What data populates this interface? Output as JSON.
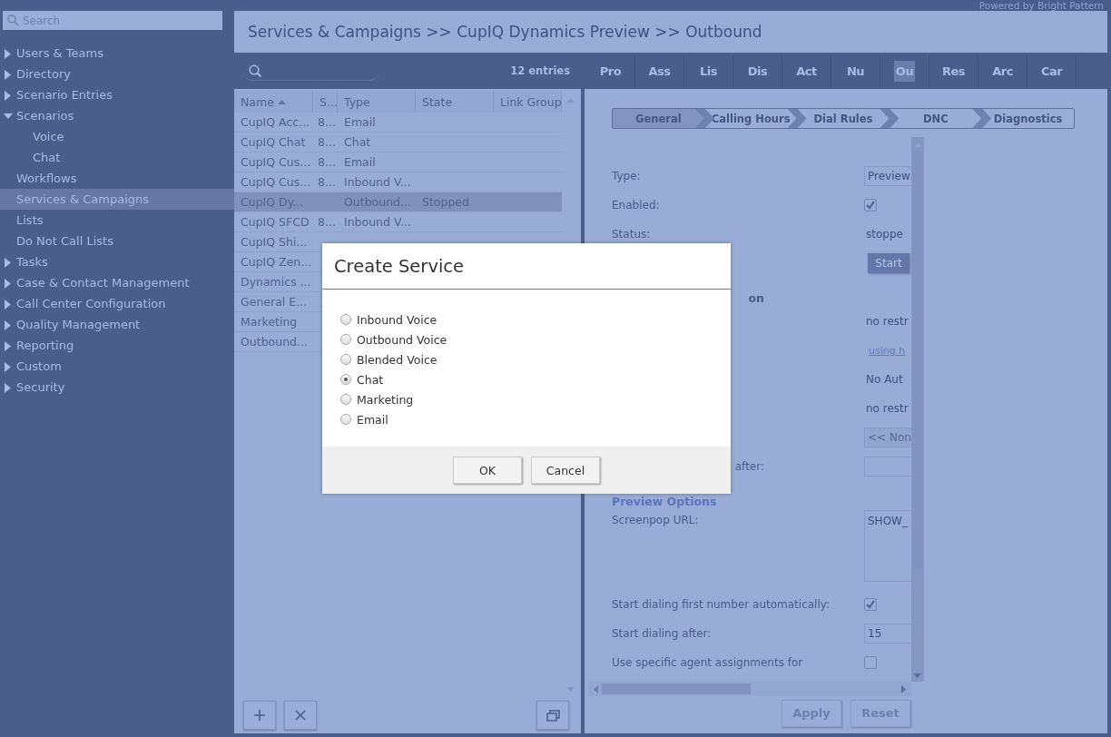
{
  "top_bar": {
    "powered_by": "Powered by Bright Pattern"
  },
  "sidebar": {
    "search": {
      "placeholder": "Search"
    },
    "items": [
      {
        "label": "Users & Teams",
        "kind": "group",
        "expanded": false,
        "selected": false
      },
      {
        "label": "Directory",
        "kind": "group",
        "expanded": false,
        "selected": false
      },
      {
        "label": "Scenario Entries",
        "kind": "group",
        "expanded": false,
        "selected": false
      },
      {
        "label": "Scenarios",
        "kind": "group",
        "expanded": true,
        "selected": false,
        "children": [
          {
            "label": "Voice",
            "selected": false
          },
          {
            "label": "Chat",
            "selected": false
          }
        ]
      },
      {
        "label": "Workflows",
        "kind": "leaf",
        "selected": false
      },
      {
        "label": "Services & Campaigns",
        "kind": "leaf",
        "selected": true
      },
      {
        "label": "Lists",
        "kind": "leaf",
        "selected": false
      },
      {
        "label": "Do Not Call Lists",
        "kind": "leaf",
        "selected": false
      },
      {
        "label": "Tasks",
        "kind": "group",
        "expanded": false,
        "selected": false
      },
      {
        "label": "Case & Contact Management",
        "kind": "group",
        "expanded": false,
        "selected": false
      },
      {
        "label": "Call Center Configuration",
        "kind": "group",
        "expanded": false,
        "selected": false
      },
      {
        "label": "Quality Management",
        "kind": "group",
        "expanded": false,
        "selected": false
      },
      {
        "label": "Reporting",
        "kind": "group",
        "expanded": false,
        "selected": false
      },
      {
        "label": "Custom",
        "kind": "group",
        "expanded": false,
        "selected": false
      },
      {
        "label": "Security",
        "kind": "group",
        "expanded": false,
        "selected": false
      }
    ]
  },
  "breadcrumb": "Services & Campaigns >> CupIQ Dynamics Preview >> Outbound",
  "list": {
    "entries": "12 entries",
    "columns": [
      {
        "label": "Name",
        "sorted": true
      },
      {
        "label": "S..."
      },
      {
        "label": "Type"
      },
      {
        "label": "State"
      },
      {
        "label": "Link Group"
      }
    ],
    "rows": [
      {
        "name": "CupIQ Acc...",
        "s": "8...",
        "type": "Email",
        "selected": false
      },
      {
        "name": "CupIQ Chat",
        "s": "8...",
        "type": "Chat",
        "selected": false
      },
      {
        "name": "CupIQ Cus...",
        "s": "8...",
        "type": "Email",
        "selected": false
      },
      {
        "name": "CupIQ Cus...",
        "s": "8...",
        "type": "Inbound V...",
        "selected": false
      },
      {
        "name": "CupIQ Dy...",
        "type": "Outbound...",
        "state": "Stopped",
        "selected": true
      },
      {
        "name": "CupIQ SFCD",
        "s": "8...",
        "type": "Inbound V...",
        "selected": false
      },
      {
        "name": "CupIQ Shi...",
        "selected": false
      },
      {
        "name": "CupIQ Zen...",
        "selected": false
      },
      {
        "name": "Dynamics ...",
        "selected": false
      },
      {
        "name": "General E...",
        "selected": false
      },
      {
        "name": "Marketing",
        "selected": false
      },
      {
        "name": "Outbound...",
        "selected": false
      }
    ]
  },
  "detail": {
    "tabs": [
      {
        "label": "Pro",
        "selected": false
      },
      {
        "label": "Ass",
        "selected": false
      },
      {
        "label": "Lis",
        "selected": false
      },
      {
        "label": "Dis",
        "selected": false
      },
      {
        "label": "Act",
        "selected": false
      },
      {
        "label": "Nu",
        "selected": false
      },
      {
        "label": "Ou",
        "selected": true
      },
      {
        "label": "Res",
        "selected": false
      },
      {
        "label": "Arc",
        "selected": false
      },
      {
        "label": "Car",
        "selected": false
      }
    ],
    "steps": [
      {
        "label": "General",
        "selected": true
      },
      {
        "label": "Calling Hours",
        "selected": false
      },
      {
        "label": "Dial Rules",
        "selected": false
      },
      {
        "label": "DNC",
        "selected": false
      },
      {
        "label": "Diagnostics",
        "selected": false
      }
    ],
    "form": [
      {
        "kind": "select",
        "label": "Type:",
        "value": "Preview"
      },
      {
        "kind": "checkbox",
        "label": "Enabled:",
        "checked": true
      },
      {
        "kind": "text",
        "label": "Status:",
        "value": "stoppe"
      },
      {
        "kind": "button",
        "value": "Start"
      },
      {
        "kind": "heading",
        "label_tail": "on"
      },
      {
        "kind": "text",
        "value": "no restr"
      },
      {
        "kind": "link",
        "value": "using h"
      },
      {
        "kind": "text",
        "value": "No Aut"
      },
      {
        "kind": "text",
        "value": "no restr"
      },
      {
        "kind": "select",
        "value": "<< Non",
        "disabled": true
      },
      {
        "kind": "input",
        "label_tail": "after:"
      },
      {
        "kind": "heading",
        "label": "Preview Options"
      },
      {
        "kind": "textarea",
        "label": "Screenpop URL:",
        "value": "SHOW_"
      },
      {
        "kind": "checkbox",
        "label": "Start dialing first number automatically:",
        "checked": true
      },
      {
        "kind": "input",
        "label": "Start dialing after:",
        "value": "15"
      },
      {
        "kind": "checkbox",
        "label": "Use specific agent assignments for",
        "checked": false
      }
    ],
    "buttons": [
      {
        "label": "Apply",
        "disabled": true
      },
      {
        "label": "Reset",
        "disabled": true
      }
    ]
  },
  "dialog": {
    "title": "Create Service",
    "options": [
      {
        "label": "Inbound Voice",
        "selected": false
      },
      {
        "label": "Outbound Voice",
        "selected": false
      },
      {
        "label": "Blended Voice",
        "selected": false
      },
      {
        "label": "Chat",
        "selected": true
      },
      {
        "label": "Marketing",
        "selected": false
      },
      {
        "label": "Email",
        "selected": false
      }
    ],
    "buttons": [
      "OK",
      "Cancel"
    ]
  }
}
